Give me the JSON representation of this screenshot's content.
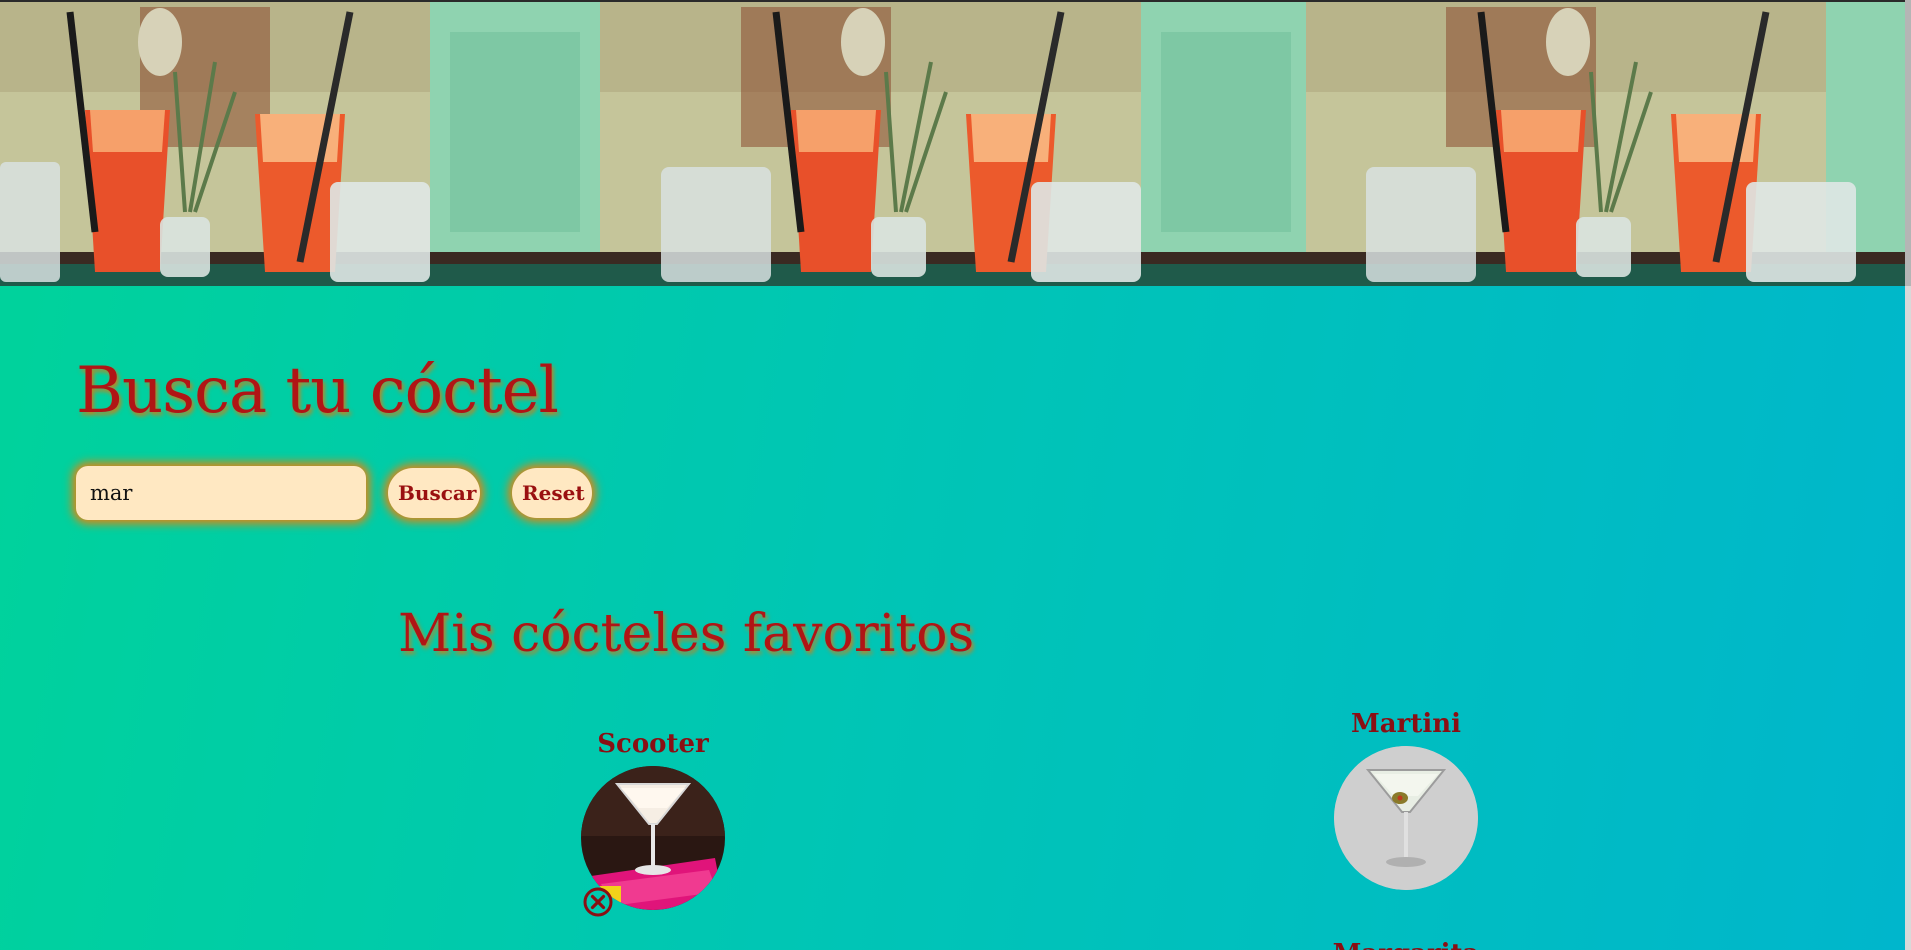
{
  "hero": {
    "image_description": "Repeated photo of iced orange cocktails with straws on a bar counter"
  },
  "search": {
    "title": "Busca tu cóctel",
    "input_value": "mar",
    "search_button_label": "Buscar",
    "reset_button_label": "Reset"
  },
  "favorites": {
    "title": "Mis cócteles favoritos",
    "items": [
      {
        "name": "Scooter",
        "photo": "white-cocktail-in-martini-glass-icon",
        "has_remove_icon": true
      },
      {
        "name": "Martini",
        "photo": "martini-with-olive-icon",
        "has_remove_icon": false
      },
      {
        "name": "Margarita",
        "photo": "",
        "has_remove_icon": false
      }
    ]
  },
  "colors": {
    "background_start": "#00d39a",
    "background_end": "#00b6cc",
    "heading_red": "#b01515",
    "glow_orange": "#ec820a",
    "control_fill": "#ffe8c2",
    "card_name": "#8a0f14"
  }
}
